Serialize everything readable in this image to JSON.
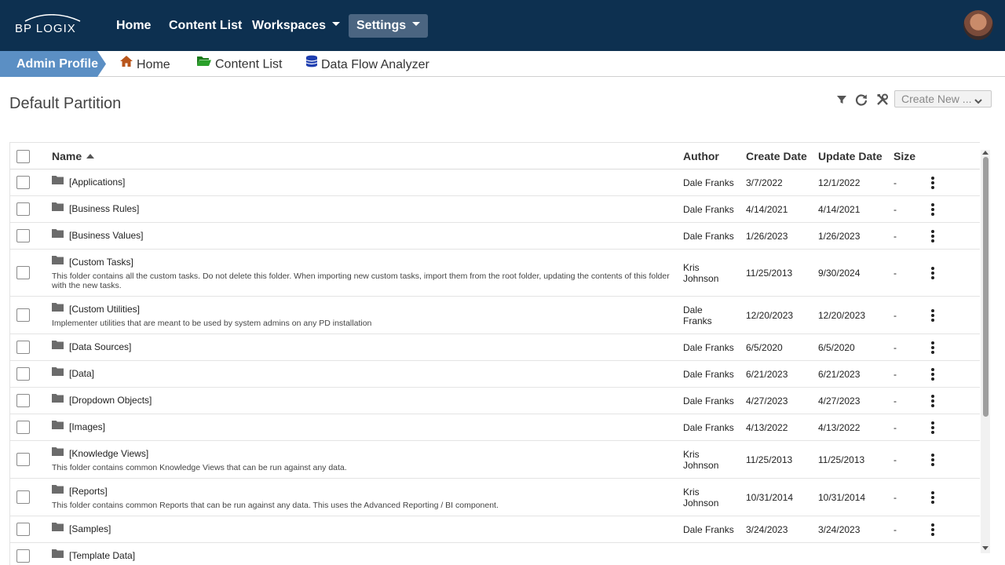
{
  "brand": {
    "logo_text": "BP LOGIX"
  },
  "nav": {
    "home": "Home",
    "content_list": "Content List",
    "workspaces": "Workspaces",
    "settings": "Settings"
  },
  "subnav": {
    "admin_profile": "Admin Profile",
    "home": "Home",
    "content_list": "Content List",
    "data_flow": "Data Flow Analyzer"
  },
  "page": {
    "title": "Default Partition",
    "create_new": "Create New ..."
  },
  "table": {
    "headers": {
      "name": "Name",
      "author": "Author",
      "create_date": "Create Date",
      "update_date": "Update Date",
      "size": "Size"
    },
    "rows": [
      {
        "name": "[Applications]",
        "desc": "",
        "author": "Dale Franks",
        "create": "3/7/2022",
        "update": "12/1/2022",
        "size": "-"
      },
      {
        "name": "[Business Rules]",
        "desc": "",
        "author": "Dale Franks",
        "create": "4/14/2021",
        "update": "4/14/2021",
        "size": "-"
      },
      {
        "name": "[Business Values]",
        "desc": "",
        "author": "Dale Franks",
        "create": "1/26/2023",
        "update": "1/26/2023",
        "size": "-"
      },
      {
        "name": "[Custom Tasks]",
        "desc": "This folder contains all the custom tasks. Do not delete this folder. When importing new custom tasks, import them from the root folder, updating the contents of this folder with the new tasks.",
        "author": "Kris Johnson",
        "create": "11/25/2013",
        "update": "9/30/2024",
        "size": "-"
      },
      {
        "name": "[Custom Utilities]",
        "desc": "Implementer utilities that are meant to be used by system admins on any PD installation",
        "author": "Dale Franks",
        "create": "12/20/2023",
        "update": "12/20/2023",
        "size": "-"
      },
      {
        "name": "[Data Sources]",
        "desc": "",
        "author": "Dale Franks",
        "create": "6/5/2020",
        "update": "6/5/2020",
        "size": "-"
      },
      {
        "name": "[Data]",
        "desc": "",
        "author": "Dale Franks",
        "create": "6/21/2023",
        "update": "6/21/2023",
        "size": "-"
      },
      {
        "name": "[Dropdown Objects]",
        "desc": "",
        "author": "Dale Franks",
        "create": "4/27/2023",
        "update": "4/27/2023",
        "size": "-"
      },
      {
        "name": "[Images]",
        "desc": "",
        "author": "Dale Franks",
        "create": "4/13/2022",
        "update": "4/13/2022",
        "size": "-"
      },
      {
        "name": "[Knowledge Views]",
        "desc": "This folder contains common Knowledge Views that can be run against any data.",
        "author": "Kris Johnson",
        "create": "11/25/2013",
        "update": "11/25/2013",
        "size": "-"
      },
      {
        "name": "[Reports]",
        "desc": "This folder contains common Reports that can be run against any data. This uses the Advanced Reporting / BI component.",
        "author": "Kris Johnson",
        "create": "10/31/2014",
        "update": "10/31/2014",
        "size": "-"
      },
      {
        "name": "[Samples]",
        "desc": "",
        "author": "Dale Franks",
        "create": "3/24/2023",
        "update": "3/24/2023",
        "size": "-"
      },
      {
        "name": "[Template Data]",
        "desc": "",
        "author": "",
        "create": "",
        "update": "",
        "size": ""
      }
    ]
  },
  "colors": {
    "topbar": "#0d3050",
    "admin_tab": "#5b8fc4",
    "settings_bg": "#4b6581"
  },
  "icons": [
    "filter-icon",
    "refresh-icon",
    "tools-icon",
    "folder-icon",
    "home-icon",
    "open-folder-icon",
    "database-icon",
    "kebab-icon"
  ]
}
